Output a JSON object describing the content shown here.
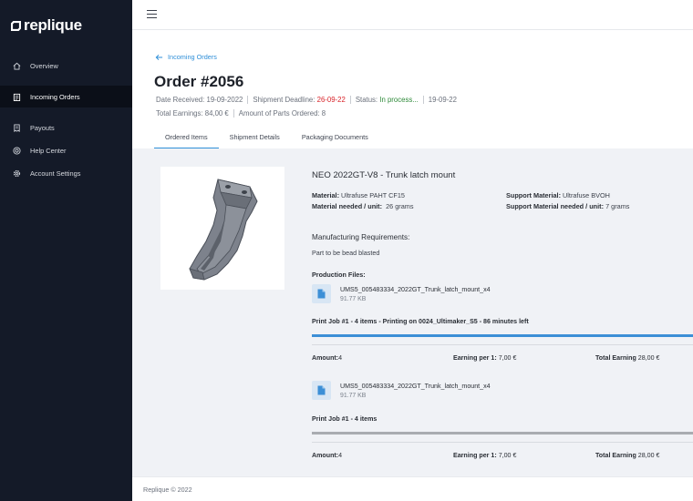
{
  "app": {
    "logo_text": "replique"
  },
  "sidebar": {
    "items": [
      {
        "label": "Overview",
        "icon": "home-icon"
      },
      {
        "label": "Incoming Orders",
        "icon": "clipboard-icon",
        "active": true
      },
      {
        "label": "Payouts",
        "icon": "receipt-icon"
      },
      {
        "label": "Help Center",
        "icon": "lifebuoy-icon"
      },
      {
        "label": "Account Settings",
        "icon": "gear-icon"
      }
    ]
  },
  "header": {
    "back_label": "Incoming Orders",
    "title": "Order #2056",
    "date_received_label": "Date Received:",
    "date_received": "19-09-2022",
    "shipment_deadline_label": "Shipment Deadline:",
    "shipment_deadline": "26-09-22",
    "status_label": "Status:",
    "status": "In process...",
    "status_date": "19-09-22",
    "total_earnings_label": "Total Earnings:",
    "total_earnings": "84,00 €",
    "parts_ordered_label": "Amount of Parts Ordered:",
    "parts_ordered": "8"
  },
  "tabs": [
    {
      "label": "Ordered Items",
      "active": true
    },
    {
      "label": "Shipment Details"
    },
    {
      "label": "Packaging Documents"
    }
  ],
  "item": {
    "title": "NEO 2022GT-V8 - Trunk latch mount",
    "material_label": "Material:",
    "material": "Ultrafuse PAHT CF15",
    "support_material_label": "Support Material:",
    "support_material": "Ultrafuse BVOH",
    "material_needed_label": "Material needed / unit:",
    "material_needed": "26 grams",
    "support_needed_label": "Support Material needed / unit:",
    "support_needed": "7 grams",
    "requirements_title": "Manufacturing Requirements:",
    "requirements": "Part to be bead blasted",
    "production_files_label": "Production Files:"
  },
  "jobs": [
    {
      "file_name": "UMS5_005483334_2022GT_Trunk_latch_mount_x4",
      "file_size": "91.77 KB",
      "job_label": "Print Job #1 - 4 items - Printing on 0024_Ultimaker_S5 - 86 minutes left",
      "progress_color": "#3c8fd6",
      "amount_label": "Amount:",
      "amount": "4",
      "earning_per_label": "Earning per 1:",
      "earning_per": "7,00 €",
      "total_label": "Total Earning",
      "total": "28,00 €"
    },
    {
      "file_name": "UMS5_005483334_2022GT_Trunk_latch_mount_x4",
      "file_size": "91.77 KB",
      "job_label": "Print Job #1 - 4 items",
      "progress_color": "#a9acb1",
      "amount_label": "Amount:",
      "amount": "4",
      "earning_per_label": "Earning per 1:",
      "earning_per": "7,00 €",
      "total_label": "Total Earning",
      "total": "28,00 €"
    }
  ],
  "footer": {
    "text": "Replique © 2022"
  },
  "colors": {
    "sidebar_bg": "#141a28",
    "accent": "#2f8fd8",
    "deadline": "#d9252b",
    "status": "#2f8a3a"
  }
}
